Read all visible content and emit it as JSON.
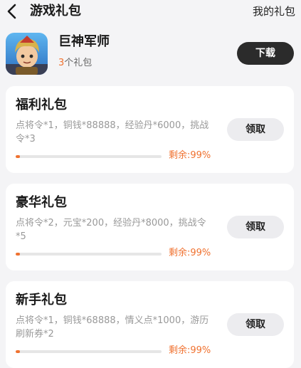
{
  "header": {
    "title": "游戏礼包",
    "my_gifts": "我的礼包",
    "back_icon": "chevron-left-icon"
  },
  "game": {
    "name": "巨神军师",
    "gift_count_num": "3",
    "gift_count_suffix": "个礼包",
    "download_label": "下载"
  },
  "colors": {
    "accent": "#f07230",
    "dark_button": "#2b2b2b",
    "background": "#f4f4f6"
  },
  "gifts": [
    {
      "title": "福利礼包",
      "desc": "点将令*1，铜钱*88888，经验丹*6000，挑战令*3",
      "remain_label": "剩余:99%",
      "remain_fraction": 0.99,
      "claim_label": "领取"
    },
    {
      "title": "豪华礼包",
      "desc": "点将令*2，元宝*200，经验丹*8000，挑战令*5",
      "remain_label": "剩余:99%",
      "remain_fraction": 0.99,
      "claim_label": "领取"
    },
    {
      "title": "新手礼包",
      "desc": "点将令*1，铜钱*68888，情义点*1000，游历刷新券*2",
      "remain_label": "剩余:99%",
      "remain_fraction": 0.99,
      "claim_label": "领取"
    }
  ]
}
